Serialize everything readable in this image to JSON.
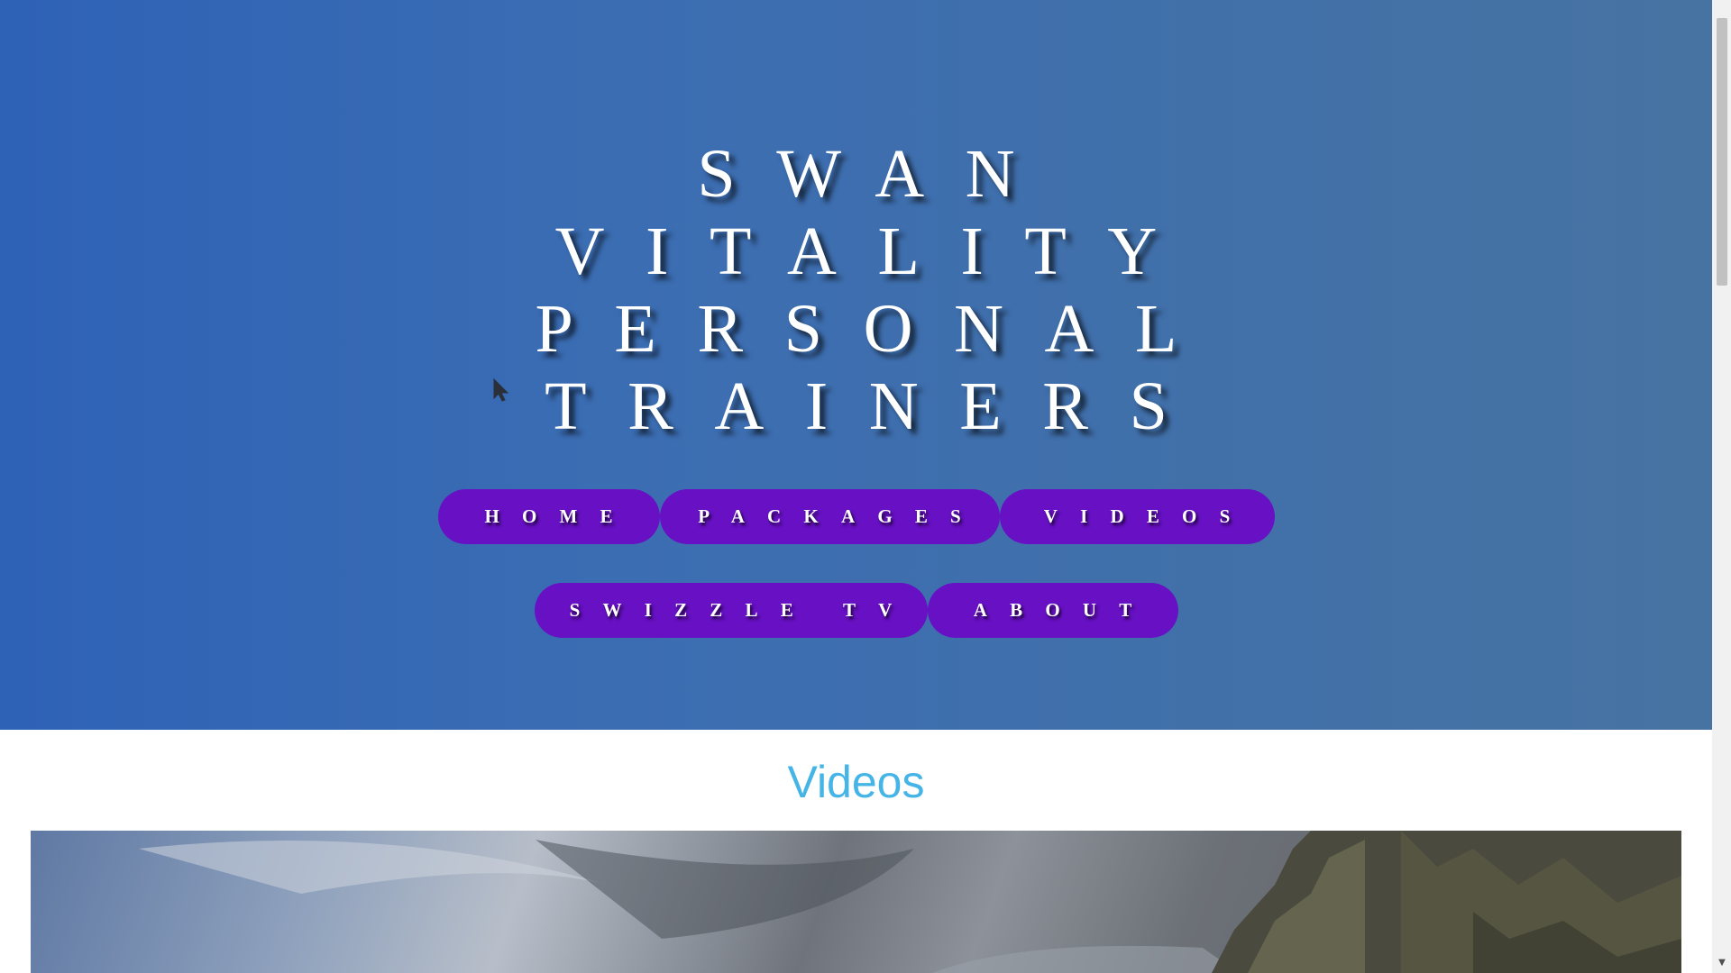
{
  "hero": {
    "title_lines": [
      "SWAN",
      "VITALITY",
      "PERSONAL",
      "TRAINERS"
    ],
    "background_colors": [
      "#2e62b6",
      "#4773a2"
    ]
  },
  "nav": {
    "button_color": "#6710c4",
    "row1": [
      "HOME",
      "PACKAGES",
      "VIDEOS"
    ],
    "row2": [
      "SWIZZLE TV",
      "ABOUT"
    ]
  },
  "videos_section": {
    "heading": "Videos",
    "heading_color": "#45b4e6",
    "banner_image": "cliff-landscape-photo"
  },
  "icons": {
    "cursor": "mouse-pointer-icon",
    "scroll_down": "chevron-down-icon"
  },
  "scrollbar": {
    "down_arrow": "▼"
  }
}
